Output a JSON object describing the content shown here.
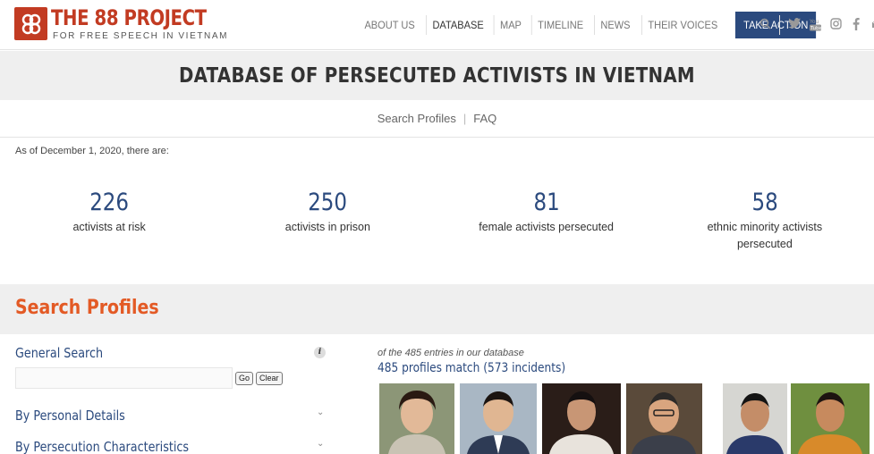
{
  "brand": {
    "title": "THE 88 PROJECT",
    "subtitle": "FOR FREE SPEECH IN VIETNAM",
    "color": "#c23b22"
  },
  "nav": {
    "items": [
      "ABOUT US",
      "DATABASE",
      "MAP",
      "TIMELINE",
      "NEWS",
      "THEIR VOICES"
    ],
    "active": "DATABASE",
    "cta": "TAKE ACTION",
    "icons": [
      "search-icon",
      "twitter-icon",
      "youtube-icon",
      "instagram-icon",
      "facebook-icon",
      "mail-icon"
    ]
  },
  "banner": {
    "title": "DATABASE OF PERSECUTED ACTIVISTS IN VIETNAM"
  },
  "subnav": {
    "items": [
      "Search Profiles",
      "FAQ"
    ]
  },
  "as_of": "As of December 1, 2020, there are:",
  "stats": [
    {
      "value": "226",
      "label": "activists at risk"
    },
    {
      "value": "250",
      "label": "activists in prison"
    },
    {
      "value": "81",
      "label": "female activists persecuted"
    },
    {
      "value": "58",
      "label": "ethnic minority activists persecuted"
    }
  ],
  "search": {
    "heading": "Search Profiles",
    "general_label": "General Search",
    "input_value": "",
    "go_label": "Go",
    "clear_label": "Clear",
    "by_personal": "By Personal Details",
    "by_persecution": "By Persecution Characteristics"
  },
  "results": {
    "note": "of the 485 entries in our database",
    "count": "485 profiles match (573 incidents)"
  },
  "colors": {
    "accent": "#2b4a7e",
    "orange": "#e35a25",
    "band": "#efefef"
  }
}
